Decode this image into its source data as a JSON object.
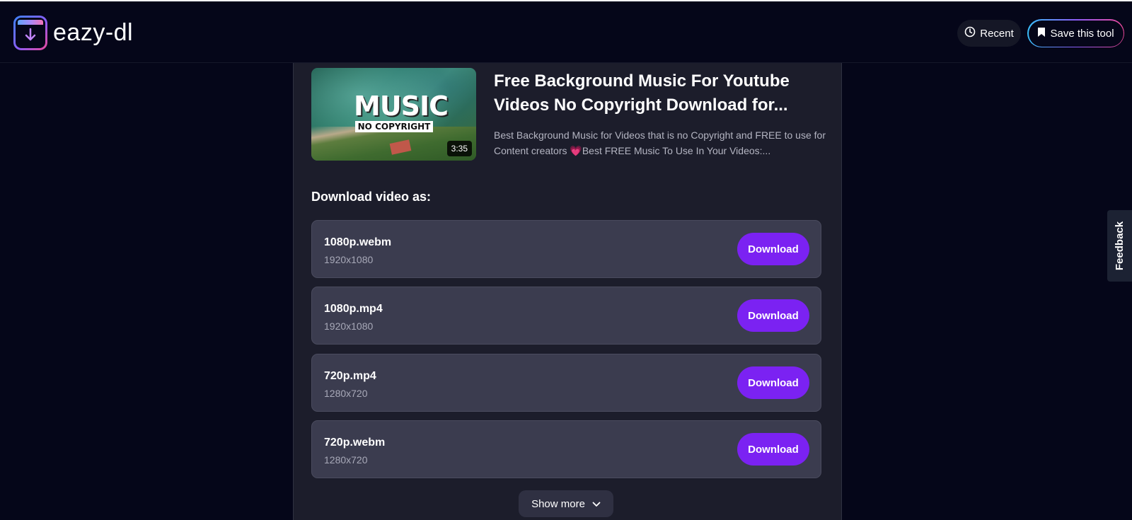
{
  "header": {
    "logo_text": "eazy-dl",
    "recent_label": "Recent",
    "save_label": "Save this tool"
  },
  "video": {
    "thumbnail_title": "MUSIC",
    "thumbnail_subtitle": "NO COPYRIGHT",
    "duration": "3:35",
    "title": "Free Background Music For Youtube Videos No Copyright Download for...",
    "description": "Best Background Music for Videos that is no Copyright and FREE to use for Content creators 💗Best FREE Music To Use In Your Videos:..."
  },
  "download_section": {
    "label": "Download video as:",
    "options": [
      {
        "format": "1080p.webm",
        "resolution": "1920x1080",
        "button": "Download"
      },
      {
        "format": "1080p.mp4",
        "resolution": "1920x1080",
        "button": "Download"
      },
      {
        "format": "720p.mp4",
        "resolution": "1280x720",
        "button": "Download"
      },
      {
        "format": "720p.webm",
        "resolution": "1280x720",
        "button": "Download"
      }
    ],
    "show_more_label": "Show more"
  },
  "feedback_label": "Feedback",
  "colors": {
    "background": "#050619",
    "panel": "#1c1d2b",
    "option_card": "#3b3c4f",
    "download_button": "#7b22f2"
  },
  "icons": {
    "logo": "download-arrow-icon",
    "recent": "clock-icon",
    "save": "bookmark-icon",
    "show_more": "chevron-down-icon"
  }
}
